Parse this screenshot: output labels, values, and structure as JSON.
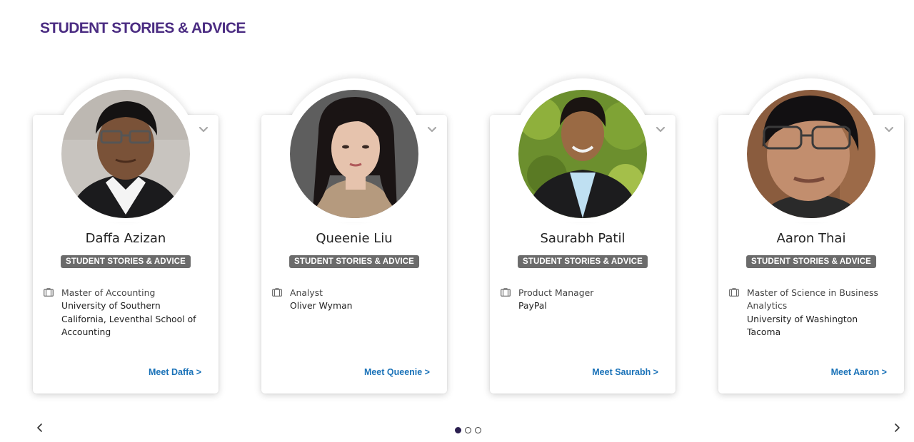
{
  "section": {
    "title": "STUDENT STORIES & ADVICE"
  },
  "cards": [
    {
      "name": "Daffa Azizan",
      "tag": "STUDENT STORIES & ADVICE",
      "job_title": "Master of Accounting",
      "org": "University of Southern California, Leventhal School of Accounting",
      "cta": "Meet Daffa >",
      "icons": {
        "expand": "chevron-down-icon",
        "job": "briefcase-icon"
      }
    },
    {
      "name": "Queenie Liu",
      "tag": "STUDENT STORIES & ADVICE",
      "job_title": "Analyst",
      "org": "Oliver Wyman",
      "cta": "Meet Queenie >",
      "icons": {
        "expand": "chevron-down-icon",
        "job": "briefcase-icon"
      }
    },
    {
      "name": "Saurabh Patil",
      "tag": "STUDENT STORIES & ADVICE",
      "job_title": "Product Manager",
      "org": "PayPal",
      "cta": "Meet Saurabh >",
      "icons": {
        "expand": "chevron-down-icon",
        "job": "briefcase-icon"
      }
    },
    {
      "name": "Aaron Thai",
      "tag": "STUDENT STORIES & ADVICE",
      "job_title": "Master of Science in Business Analytics",
      "org": "University of Washington Tacoma",
      "cta": "Meet Aaron >",
      "icons": {
        "expand": "chevron-down-icon",
        "job": "briefcase-icon"
      }
    }
  ],
  "carousel": {
    "page_count": 3,
    "active_page": 1,
    "prev_icon": "chevron-left-icon",
    "next_icon": "chevron-right-icon"
  },
  "colors": {
    "title": "#4b2c82",
    "tag_bg": "#6b6b6b",
    "link": "#1a72b8",
    "active_dot": "#2a1f4f"
  }
}
